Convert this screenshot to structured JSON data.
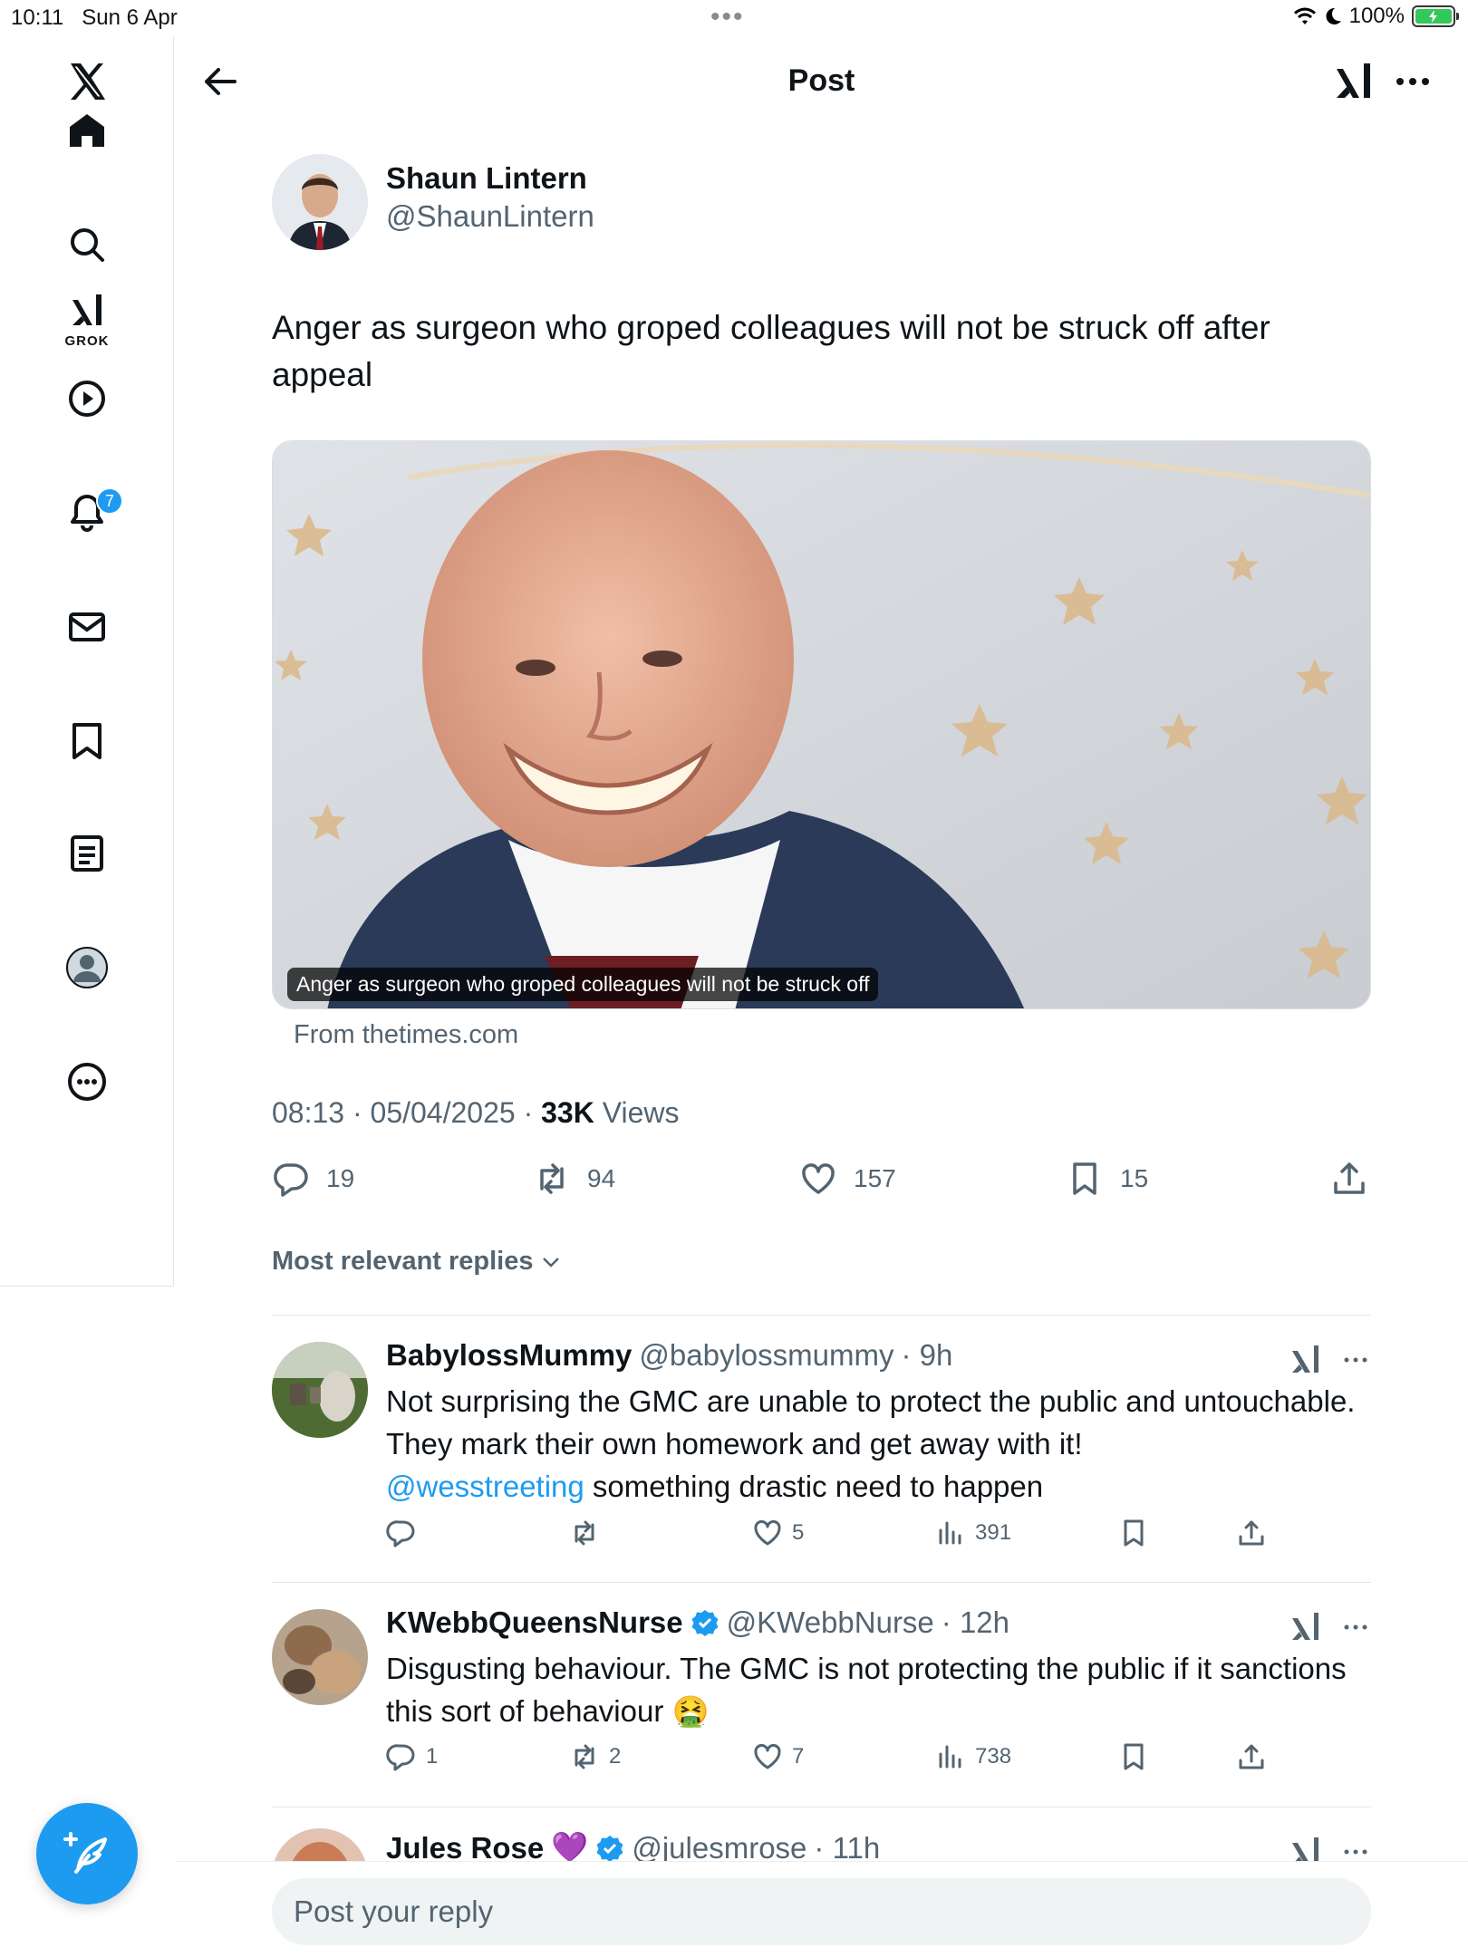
{
  "status_bar": {
    "time": "10:11",
    "date": "Sun 6 Apr",
    "battery": "100%"
  },
  "sidebar": {
    "grok_label": "GROK",
    "notifications_count": "7",
    "items": [
      "home-icon",
      "search-icon",
      "grok-icon",
      "video-icon",
      "bell-icon",
      "mail-icon",
      "bookmark-icon",
      "lists-icon",
      "profile-icon",
      "more-icon"
    ]
  },
  "header": {
    "title": "Post"
  },
  "post": {
    "author_name": "Shaun Lintern",
    "author_handle": "@ShaunLintern",
    "text": "Anger as surgeon who groped colleagues will not be struck off after appeal",
    "card_caption": "Anger as surgeon who groped colleagues will not be struck off",
    "card_source": "From thetimes.com",
    "time": "08:13 · 05/04/2025 · ",
    "views_count": "33K",
    "views_label": " Views",
    "replies": "19",
    "reposts": "94",
    "likes": "157",
    "bookmarks": "15"
  },
  "replies_section": {
    "sort_label": "Most relevant replies"
  },
  "replies": [
    {
      "name": "BabylossMummy",
      "handle": "@babylossmummy",
      "time": "· 9h",
      "text": "Not surprising the GMC are unable to protect the public and untouchable. They mark their own homework and get away with it!",
      "mention": "@wesstreeting",
      "text_after": " something drastic need to happen",
      "replies": "",
      "reposts": "",
      "likes": "5",
      "views": "391"
    },
    {
      "name": "KWebbQueensNurse",
      "handle": "@KWebbNurse",
      "time": "· 12h",
      "text": "Disgusting behaviour. The GMC is not protecting the public if it sanctions this sort of behaviour 🤮",
      "replies": "1",
      "reposts": "2",
      "likes": "7",
      "views": "738"
    },
    {
      "name": "Jules Rose",
      "handle": "@julesmrose",
      "time": "· 11h",
      "emoji": "💜"
    }
  ],
  "composer": {
    "placeholder": "Post your reply"
  },
  "colors": {
    "accent": "#1d9bf0",
    "text": "#0f1419",
    "muted": "#536471"
  }
}
